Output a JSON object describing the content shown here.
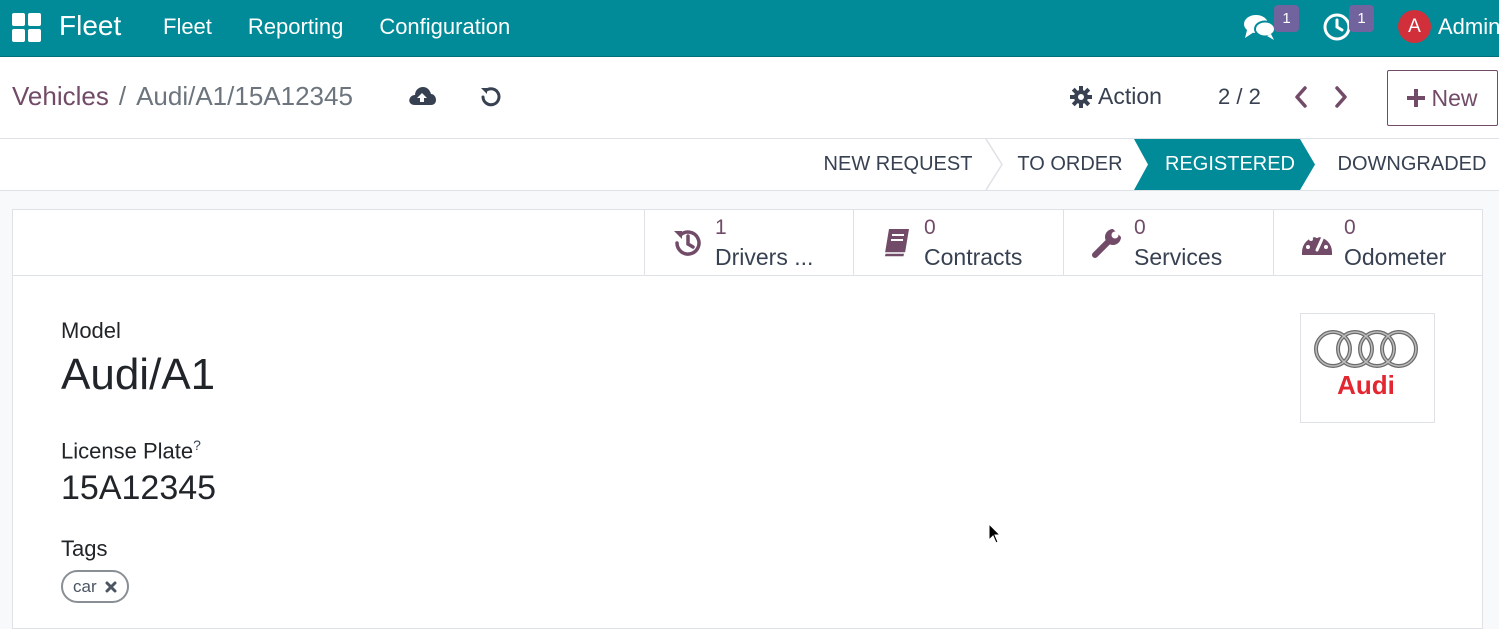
{
  "navbar": {
    "app_name": "Fleet",
    "menu": [
      "Fleet",
      "Reporting",
      "Configuration"
    ],
    "messages_count": "1",
    "activities_count": "1",
    "avatar_letter": "A",
    "user_name": "Admin"
  },
  "breadcrumb": {
    "parent": "Vehicles",
    "separator": "/",
    "current": "Audi/A1/15A12345"
  },
  "toolbar": {
    "action_label": "Action",
    "pager": "2 / 2",
    "new_label": "New"
  },
  "statusbar": {
    "stages": [
      "NEW REQUEST",
      "TO ORDER",
      "REGISTERED",
      "DOWNGRADED"
    ],
    "active": "REGISTERED"
  },
  "smart_buttons": [
    {
      "value": "1",
      "label": "Drivers ...",
      "icon": "history-icon"
    },
    {
      "value": "0",
      "label": "Contracts",
      "icon": "book-icon"
    },
    {
      "value": "0",
      "label": "Services",
      "icon": "wrench-icon"
    },
    {
      "value": "0",
      "label": "Odometer",
      "icon": "tachometer-icon"
    }
  ],
  "form": {
    "model_label": "Model",
    "model_value": "Audi/A1",
    "plate_label": "License Plate",
    "plate_help": "?",
    "plate_value": "15A12345",
    "tags_label": "Tags",
    "tags": [
      "car"
    ],
    "logo_text": "Audi"
  },
  "colors": {
    "brand": "#018a98",
    "primary": "#714b67",
    "badge": "#71639e",
    "avatar": "#d1303a",
    "logo_red": "#e3262f"
  }
}
